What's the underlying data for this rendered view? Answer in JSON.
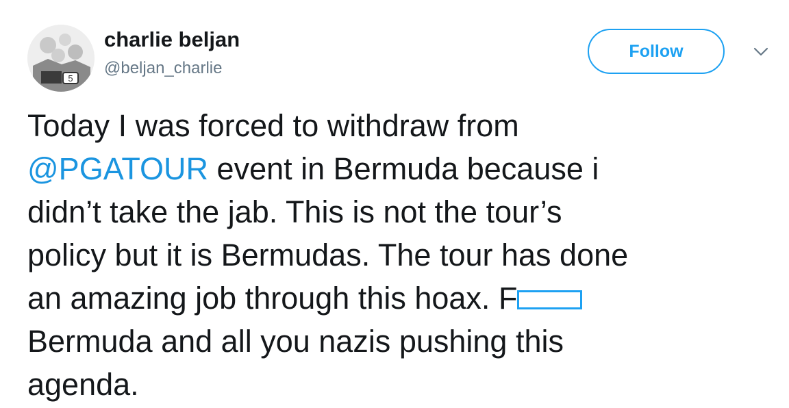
{
  "user": {
    "display_name": "charlie beljan",
    "handle": "@beljan_charlie",
    "avatar_icon": "user-avatar"
  },
  "actions": {
    "follow_label": "Follow",
    "menu_icon": "chevron-down-icon"
  },
  "tweet": {
    "line1": "Today I was forced to withdraw from",
    "mention": "@PGATOUR",
    "line2_rest": " event in Bermuda because i",
    "line3": "didn’t take the jab. This is not the tour’s",
    "line4": "policy but it is Bermudas. The tour has done",
    "line5": "an amazing job through this hoax. F",
    "line6": "Bermuda and all you nazis pushing this",
    "line7": "agenda."
  },
  "colors": {
    "accent": "#1da1f2",
    "mention": "#1b95e0",
    "text": "#14171a",
    "muted": "#657786"
  }
}
